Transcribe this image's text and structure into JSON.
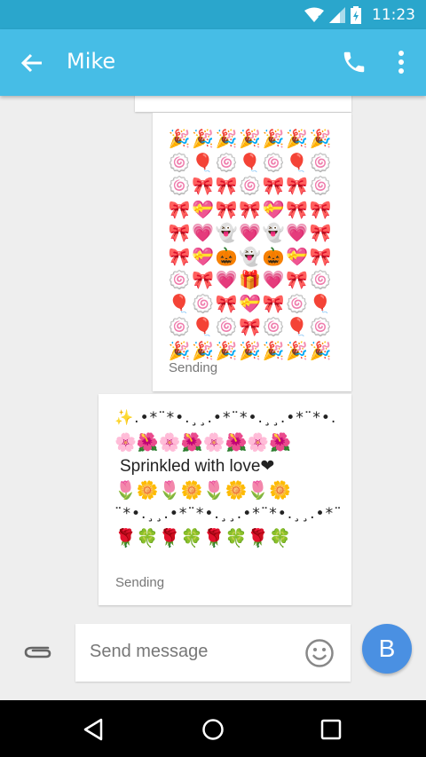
{
  "status_bar": {
    "time": "11:23"
  },
  "app_bar": {
    "title": "Mike"
  },
  "messages": [
    {
      "grid_rows": [
        [
          "🎉",
          "🎉",
          "🎉",
          "🎉",
          "🎉",
          "🎉",
          "🎉"
        ],
        [
          "🍥",
          "🎈",
          "🍥",
          "🎈",
          "🍥",
          "🎈",
          "🍥"
        ],
        [
          "🍥",
          "🎀",
          "🎀",
          "🍥",
          "🎀",
          "🎀",
          "🍥"
        ],
        [
          "🎀",
          "💝",
          "🎀",
          "🎀",
          "💝",
          "🎀",
          "🎀"
        ],
        [
          "🎀",
          "💗",
          "👻",
          "💗",
          "👻",
          "💗",
          "🎀"
        ],
        [
          "🎀",
          "💝",
          "🎃",
          "👻",
          "🎃",
          "💝",
          "🎀"
        ],
        [
          "🍥",
          "🎀",
          "💗",
          "🎁",
          "💗",
          "🎀",
          "🍥"
        ],
        [
          "🎈",
          "🍥",
          "🎀",
          "💝",
          "🎀",
          "🍥",
          "🎈"
        ],
        [
          "🍥",
          "🎈",
          "🍥",
          "🎀",
          "🍥",
          "🎈",
          "🍥"
        ],
        [
          "🎉",
          "🎉",
          "🎉",
          "🎉",
          "🎉",
          "🎉",
          "🎉"
        ]
      ],
      "status": "Sending"
    },
    {
      "line1": "✨.•*¨*•.¸¸.•*¨*•.¸¸.•*¨*•. ƸӜƷ",
      "line2": "🌸🌺🌸🌺🌸🌺🌸🌺",
      "line3": "Sprinkled with love❤",
      "line4": "🌷🌼🌷🌼🌷🌼🌷🌼",
      "line5": "¨*•.¸¸.•*¨*•.¸¸.•*¨*•.¸¸.•*¨*•. ✨",
      "line6": "🌹🍀🌹🍀🌹🍀🌹🍀",
      "status": "Sending"
    }
  ],
  "composer": {
    "placeholder": "Send message",
    "send_label": "B"
  }
}
